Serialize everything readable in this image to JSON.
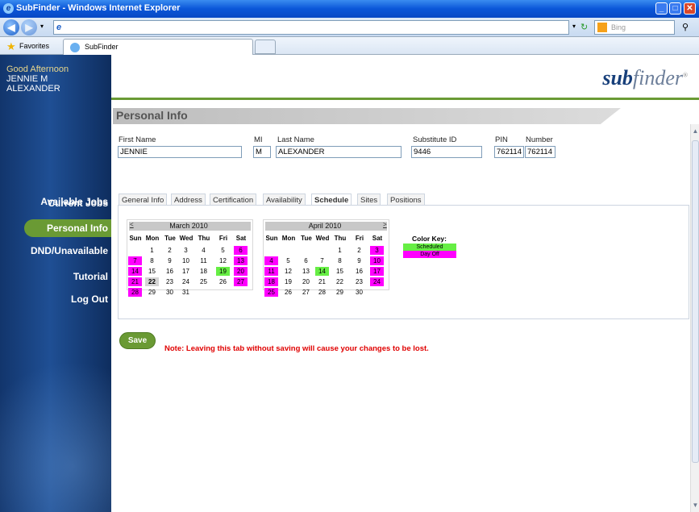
{
  "window": {
    "title": "SubFinder - Windows Internet Explorer"
  },
  "browser": {
    "address_glyph": "e",
    "search_placeholder": "Bing",
    "favorites_label": "Favorites",
    "tab_label": "SubFinder"
  },
  "sidebar": {
    "greeting": "Good Afternoon",
    "user_line1": "JENNIE M",
    "user_line2": "ALEXANDER",
    "items": [
      {
        "label": "Available Jobs"
      },
      {
        "label": "Current Jobs"
      },
      {
        "label": "Personal Info",
        "active": true
      },
      {
        "label": "DND/Unavailable"
      },
      {
        "label": "Tutorial"
      },
      {
        "label": "Log Out"
      }
    ]
  },
  "header": {
    "logo_sub": "sub",
    "logo_finder": "finder",
    "logo_mark": "®"
  },
  "page": {
    "title": "Personal Info"
  },
  "form": {
    "labels": {
      "first": "First Name",
      "mi": "MI",
      "last": "Last Name",
      "subid": "Substitute ID",
      "pin": "PIN",
      "number": "Number"
    },
    "values": {
      "first": "JENNIE",
      "mi": "M",
      "last": "ALEXANDER",
      "subid": "9446",
      "pin": "762114",
      "number": "762114"
    }
  },
  "tabs": [
    "General Info",
    "Address",
    "Certification",
    "Availability",
    "Schedule",
    "Sites",
    "Positions"
  ],
  "active_tab": "Schedule",
  "calendars": {
    "prev": "<",
    "next": ">",
    "weekdays": [
      "Sun",
      "Mon",
      "Tue",
      "Wed",
      "Thu",
      "Fri",
      "Sat"
    ],
    "months": [
      {
        "title": "March 2010",
        "days": [
          {
            "d": "1",
            "s": 0
          },
          {
            "d": "2",
            "s": 0
          },
          {
            "d": "3",
            "s": 0
          },
          {
            "d": "4",
            "s": 0
          },
          {
            "d": "5",
            "s": 0
          },
          {
            "d": "6",
            "s": 2
          },
          {
            "d": "7",
            "s": 2
          },
          {
            "d": "8",
            "s": 0
          },
          {
            "d": "9",
            "s": 0
          },
          {
            "d": "10",
            "s": 0
          },
          {
            "d": "11",
            "s": 0
          },
          {
            "d": "12",
            "s": 0
          },
          {
            "d": "13",
            "s": 2
          },
          {
            "d": "14",
            "s": 2
          },
          {
            "d": "15",
            "s": 0
          },
          {
            "d": "16",
            "s": 0
          },
          {
            "d": "17",
            "s": 0
          },
          {
            "d": "18",
            "s": 0
          },
          {
            "d": "19",
            "s": 1
          },
          {
            "d": "20",
            "s": 2
          },
          {
            "d": "21",
            "s": 2
          },
          {
            "d": "22",
            "s": 3
          },
          {
            "d": "23",
            "s": 0
          },
          {
            "d": "24",
            "s": 0
          },
          {
            "d": "25",
            "s": 0
          },
          {
            "d": "26",
            "s": 0
          },
          {
            "d": "27",
            "s": 2
          },
          {
            "d": "28",
            "s": 2
          },
          {
            "d": "29",
            "s": 0
          },
          {
            "d": "30",
            "s": 0
          },
          {
            "d": "31",
            "s": 0
          }
        ]
      },
      {
        "title": "April 2010",
        "days": [
          {
            "d": "1",
            "s": 0
          },
          {
            "d": "2",
            "s": 0
          },
          {
            "d": "3",
            "s": 2
          },
          {
            "d": "4",
            "s": 2
          },
          {
            "d": "5",
            "s": 0
          },
          {
            "d": "6",
            "s": 0
          },
          {
            "d": "7",
            "s": 0
          },
          {
            "d": "8",
            "s": 0
          },
          {
            "d": "9",
            "s": 0
          },
          {
            "d": "10",
            "s": 2
          },
          {
            "d": "11",
            "s": 2
          },
          {
            "d": "12",
            "s": 0
          },
          {
            "d": "13",
            "s": 0
          },
          {
            "d": "14",
            "s": 1
          },
          {
            "d": "15",
            "s": 0
          },
          {
            "d": "16",
            "s": 0
          },
          {
            "d": "17",
            "s": 2
          },
          {
            "d": "18",
            "s": 2
          },
          {
            "d": "19",
            "s": 0
          },
          {
            "d": "20",
            "s": 0
          },
          {
            "d": "21",
            "s": 0
          },
          {
            "d": "22",
            "s": 0
          },
          {
            "d": "23",
            "s": 0
          },
          {
            "d": "24",
            "s": 2
          },
          {
            "d": "25",
            "s": 2
          },
          {
            "d": "26",
            "s": 0
          },
          {
            "d": "27",
            "s": 0
          },
          {
            "d": "28",
            "s": 0
          },
          {
            "d": "29",
            "s": 0
          },
          {
            "d": "30",
            "s": 0
          }
        ]
      }
    ]
  },
  "color_key": {
    "title": "Color Key:",
    "scheduled": "Scheduled",
    "day_off": "Day Off"
  },
  "colors": {
    "scheduled": "#66ee44",
    "day_off": "#ff00ff",
    "today": "#d4d4d4",
    "accent": "#6a9a34",
    "nav": "#1f4f94",
    "warning": "#e00000"
  },
  "actions": {
    "save": "Save",
    "note": "Note: Leaving this tab without saving will cause your changes to be lost."
  }
}
